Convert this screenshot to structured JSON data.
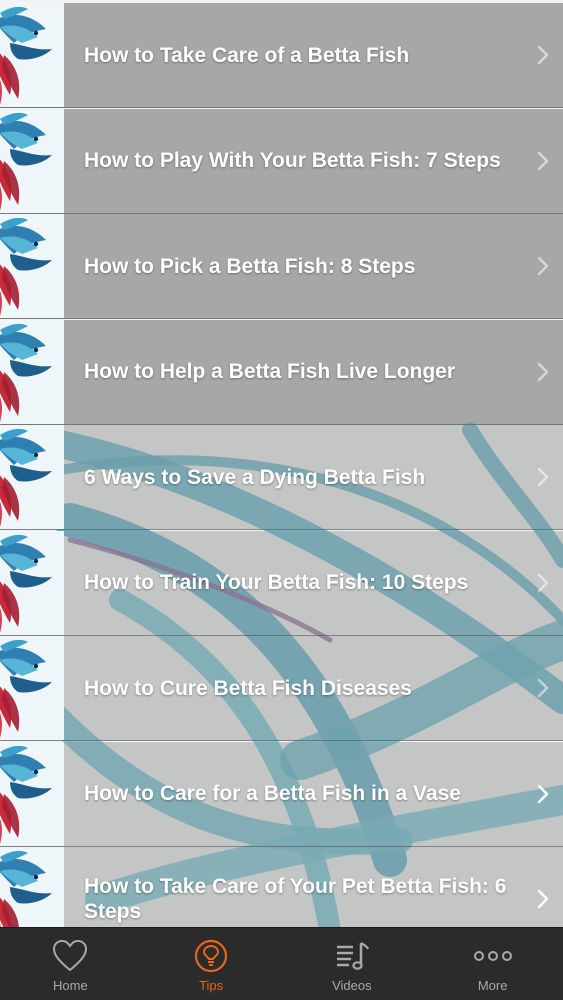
{
  "items": [
    {
      "title": "How to Take Care of a Betta Fish"
    },
    {
      "title": "How to Play With Your Betta Fish: 7 Steps"
    },
    {
      "title": "How to Pick a Betta Fish: 8 Steps"
    },
    {
      "title": "How to Help a Betta Fish Live Longer"
    },
    {
      "title": "6 Ways to Save a Dying Betta Fish"
    },
    {
      "title": "How to Train Your Betta Fish: 10 Steps"
    },
    {
      "title": "How to Cure Betta Fish Diseases"
    },
    {
      "title": "How to Care for a Betta Fish in a Vase"
    },
    {
      "title": "How to Take Care of Your Pet Betta Fish: 6 Steps"
    }
  ],
  "tabs": [
    {
      "label": "Home",
      "icon": "heart-icon"
    },
    {
      "label": "Tips",
      "icon": "tips-icon",
      "active": true
    },
    {
      "label": "Videos",
      "icon": "music-list-icon"
    },
    {
      "label": "More",
      "icon": "more-dots-icon"
    }
  ],
  "colors": {
    "accent": "#e8651a",
    "tabbar": "#2b2b2b",
    "row_overlay": "#969696"
  }
}
